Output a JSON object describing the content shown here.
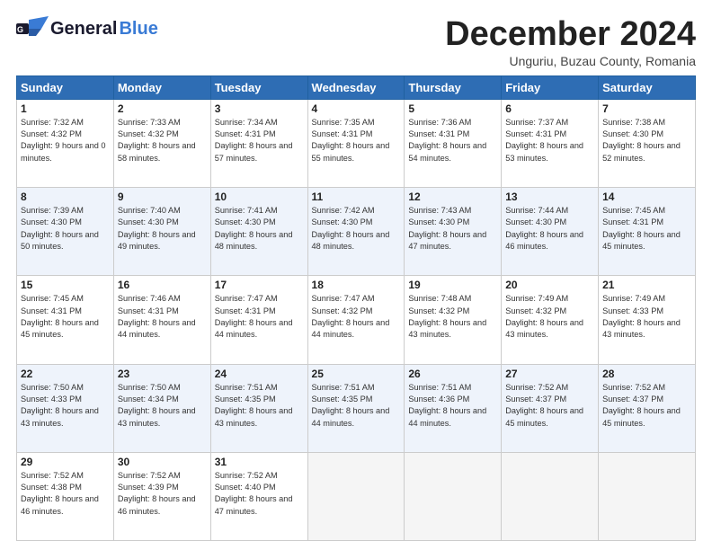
{
  "header": {
    "logo_general": "General",
    "logo_blue": "Blue",
    "month_title": "December 2024",
    "location": "Unguriu, Buzau County, Romania"
  },
  "days_of_week": [
    "Sunday",
    "Monday",
    "Tuesday",
    "Wednesday",
    "Thursday",
    "Friday",
    "Saturday"
  ],
  "weeks": [
    [
      {
        "day": "1",
        "sunrise": "Sunrise: 7:32 AM",
        "sunset": "Sunset: 4:32 PM",
        "daylight": "Daylight: 9 hours and 0 minutes."
      },
      {
        "day": "2",
        "sunrise": "Sunrise: 7:33 AM",
        "sunset": "Sunset: 4:32 PM",
        "daylight": "Daylight: 8 hours and 58 minutes."
      },
      {
        "day": "3",
        "sunrise": "Sunrise: 7:34 AM",
        "sunset": "Sunset: 4:31 PM",
        "daylight": "Daylight: 8 hours and 57 minutes."
      },
      {
        "day": "4",
        "sunrise": "Sunrise: 7:35 AM",
        "sunset": "Sunset: 4:31 PM",
        "daylight": "Daylight: 8 hours and 55 minutes."
      },
      {
        "day": "5",
        "sunrise": "Sunrise: 7:36 AM",
        "sunset": "Sunset: 4:31 PM",
        "daylight": "Daylight: 8 hours and 54 minutes."
      },
      {
        "day": "6",
        "sunrise": "Sunrise: 7:37 AM",
        "sunset": "Sunset: 4:31 PM",
        "daylight": "Daylight: 8 hours and 53 minutes."
      },
      {
        "day": "7",
        "sunrise": "Sunrise: 7:38 AM",
        "sunset": "Sunset: 4:30 PM",
        "daylight": "Daylight: 8 hours and 52 minutes."
      }
    ],
    [
      {
        "day": "8",
        "sunrise": "Sunrise: 7:39 AM",
        "sunset": "Sunset: 4:30 PM",
        "daylight": "Daylight: 8 hours and 50 minutes."
      },
      {
        "day": "9",
        "sunrise": "Sunrise: 7:40 AM",
        "sunset": "Sunset: 4:30 PM",
        "daylight": "Daylight: 8 hours and 49 minutes."
      },
      {
        "day": "10",
        "sunrise": "Sunrise: 7:41 AM",
        "sunset": "Sunset: 4:30 PM",
        "daylight": "Daylight: 8 hours and 48 minutes."
      },
      {
        "day": "11",
        "sunrise": "Sunrise: 7:42 AM",
        "sunset": "Sunset: 4:30 PM",
        "daylight": "Daylight: 8 hours and 48 minutes."
      },
      {
        "day": "12",
        "sunrise": "Sunrise: 7:43 AM",
        "sunset": "Sunset: 4:30 PM",
        "daylight": "Daylight: 8 hours and 47 minutes."
      },
      {
        "day": "13",
        "sunrise": "Sunrise: 7:44 AM",
        "sunset": "Sunset: 4:30 PM",
        "daylight": "Daylight: 8 hours and 46 minutes."
      },
      {
        "day": "14",
        "sunrise": "Sunrise: 7:45 AM",
        "sunset": "Sunset: 4:31 PM",
        "daylight": "Daylight: 8 hours and 45 minutes."
      }
    ],
    [
      {
        "day": "15",
        "sunrise": "Sunrise: 7:45 AM",
        "sunset": "Sunset: 4:31 PM",
        "daylight": "Daylight: 8 hours and 45 minutes."
      },
      {
        "day": "16",
        "sunrise": "Sunrise: 7:46 AM",
        "sunset": "Sunset: 4:31 PM",
        "daylight": "Daylight: 8 hours and 44 minutes."
      },
      {
        "day": "17",
        "sunrise": "Sunrise: 7:47 AM",
        "sunset": "Sunset: 4:31 PM",
        "daylight": "Daylight: 8 hours and 44 minutes."
      },
      {
        "day": "18",
        "sunrise": "Sunrise: 7:47 AM",
        "sunset": "Sunset: 4:32 PM",
        "daylight": "Daylight: 8 hours and 44 minutes."
      },
      {
        "day": "19",
        "sunrise": "Sunrise: 7:48 AM",
        "sunset": "Sunset: 4:32 PM",
        "daylight": "Daylight: 8 hours and 43 minutes."
      },
      {
        "day": "20",
        "sunrise": "Sunrise: 7:49 AM",
        "sunset": "Sunset: 4:32 PM",
        "daylight": "Daylight: 8 hours and 43 minutes."
      },
      {
        "day": "21",
        "sunrise": "Sunrise: 7:49 AM",
        "sunset": "Sunset: 4:33 PM",
        "daylight": "Daylight: 8 hours and 43 minutes."
      }
    ],
    [
      {
        "day": "22",
        "sunrise": "Sunrise: 7:50 AM",
        "sunset": "Sunset: 4:33 PM",
        "daylight": "Daylight: 8 hours and 43 minutes."
      },
      {
        "day": "23",
        "sunrise": "Sunrise: 7:50 AM",
        "sunset": "Sunset: 4:34 PM",
        "daylight": "Daylight: 8 hours and 43 minutes."
      },
      {
        "day": "24",
        "sunrise": "Sunrise: 7:51 AM",
        "sunset": "Sunset: 4:35 PM",
        "daylight": "Daylight: 8 hours and 43 minutes."
      },
      {
        "day": "25",
        "sunrise": "Sunrise: 7:51 AM",
        "sunset": "Sunset: 4:35 PM",
        "daylight": "Daylight: 8 hours and 44 minutes."
      },
      {
        "day": "26",
        "sunrise": "Sunrise: 7:51 AM",
        "sunset": "Sunset: 4:36 PM",
        "daylight": "Daylight: 8 hours and 44 minutes."
      },
      {
        "day": "27",
        "sunrise": "Sunrise: 7:52 AM",
        "sunset": "Sunset: 4:37 PM",
        "daylight": "Daylight: 8 hours and 45 minutes."
      },
      {
        "day": "28",
        "sunrise": "Sunrise: 7:52 AM",
        "sunset": "Sunset: 4:37 PM",
        "daylight": "Daylight: 8 hours and 45 minutes."
      }
    ],
    [
      {
        "day": "29",
        "sunrise": "Sunrise: 7:52 AM",
        "sunset": "Sunset: 4:38 PM",
        "daylight": "Daylight: 8 hours and 46 minutes."
      },
      {
        "day": "30",
        "sunrise": "Sunrise: 7:52 AM",
        "sunset": "Sunset: 4:39 PM",
        "daylight": "Daylight: 8 hours and 46 minutes."
      },
      {
        "day": "31",
        "sunrise": "Sunrise: 7:52 AM",
        "sunset": "Sunset: 4:40 PM",
        "daylight": "Daylight: 8 hours and 47 minutes."
      },
      null,
      null,
      null,
      null
    ]
  ]
}
